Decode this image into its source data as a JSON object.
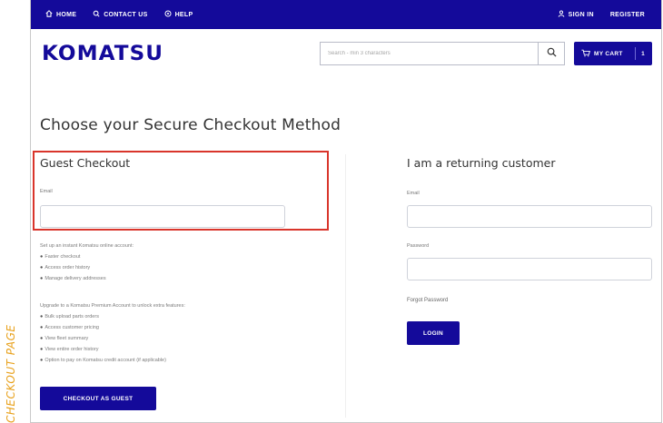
{
  "side_label": "CHECKOUT PAGE",
  "topbar": {
    "home": "HOME",
    "contact": "CONTACT US",
    "help": "HELP",
    "sign_in": "SIGN IN",
    "register": "REGISTER"
  },
  "header": {
    "logo": "KOMATSU",
    "search_placeholder": "Search - min 3 characters",
    "cart_label": "MY CART",
    "cart_count": "1"
  },
  "page_title": "Choose your Secure Checkout Method",
  "guest": {
    "title": "Guest Checkout",
    "email_label": "Email",
    "email_value": "",
    "intro": "Set up an instant Komatsu online account:",
    "benefits": [
      "Faster checkout",
      "Access order history",
      "Manage delivery addresses"
    ],
    "upgrade_intro": "Upgrade to a Komatsu Premium Account to unlock extra features:",
    "premium_features": [
      "Bulk upload parts orders",
      "Access customer pricing",
      "View fleet summary",
      "View entire order history",
      "Option to pay on Komatsu credit account (if applicable)"
    ],
    "button": "CHECKOUT AS GUEST"
  },
  "returning": {
    "title": "I am a returning customer",
    "email_label": "Email",
    "password_label": "Password",
    "forgot": "Forgot Password",
    "button": "LOGIN"
  },
  "colors": {
    "brand_navy": "#140a9a",
    "highlight_red": "#d9352b",
    "side_label_orange": "#e8a11c"
  }
}
